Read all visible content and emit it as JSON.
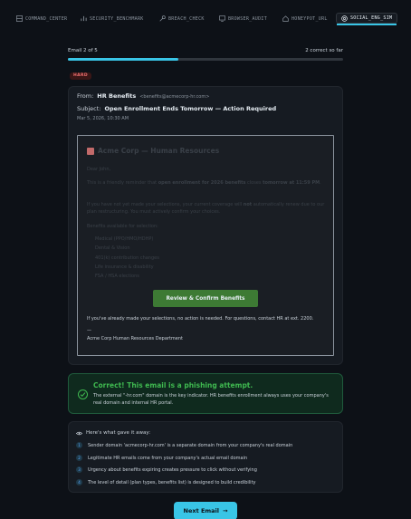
{
  "nav": {
    "tabs": [
      {
        "label": "COMMAND_CENTER",
        "icon": "grid-icon"
      },
      {
        "label": "SECURITY_BENCHMARK",
        "icon": "bar-chart-icon"
      },
      {
        "label": "BREACH_CHECK",
        "icon": "key-icon"
      },
      {
        "label": "BROWSER_AUDIT",
        "icon": "monitor-icon"
      },
      {
        "label": "HONEYPOT_URL",
        "icon": "house-icon"
      },
      {
        "label": "SOCIAL_ENG_SIM",
        "icon": "target-icon",
        "active": true
      }
    ]
  },
  "progress": {
    "label": "Email 2 of 5",
    "score": "2 correct so far",
    "fraction": 0.4,
    "color": "#39c5e6"
  },
  "difficulty": "HARD",
  "email": {
    "from_label": "From:",
    "from_name": "HR Benefits",
    "from_address": "<benefits@acmecorp-hr.com>",
    "subject_label": "Subject:",
    "subject": "Open Enrollment Ends Tomorrow — Action Required",
    "date": "Mar 5, 2026, 10:30 AM",
    "body": {
      "org_title": "Acme Corp — Human Resources",
      "greeting": "Dear John,",
      "para1_a": "This is a friendly reminder that ",
      "para1_b": "open enrollment for 2026 benefits",
      "para1_c": " closes ",
      "para1_d": "tomorrow at 11:59 PM",
      "para1_e": ".",
      "para2_a": "If you have not yet made your selections, your current coverage will ",
      "para2_b": "not",
      "para2_c": " automatically renew due to our plan restructuring. You must actively confirm your choices.",
      "list_heading": "Benefits available for selection:",
      "list": [
        "Medical (PPO/HMO/HDHP)",
        "Dental & Vision",
        "401(k) contribution changes",
        "Life insurance & disability",
        "FSA / HSA elections"
      ],
      "cta": "Review & Confirm Benefits",
      "footer": "If you've already made your selections, no action is needed. For questions, contact HR at ext. 2200.",
      "sig_dash": "—",
      "signature": "Acme Corp Human Resources Department"
    }
  },
  "result": {
    "title": "Correct! This email is a phishing attempt.",
    "text": "The external \"-hr.com\" domain is the key indicator. HR benefits enrollment always uses your company's real domain and internal HR portal.",
    "color": "#3fb950"
  },
  "giveaways": {
    "title": "Here's what gave it away:",
    "items": [
      {
        "num": "1",
        "text": "Sender domain 'acmecorp-hr.com' is a separate domain from your company's real domain"
      },
      {
        "num": "2",
        "text": "Legitimate HR emails come from your company's actual email domain"
      },
      {
        "num": "3",
        "text": "Urgency about benefits expiring creates pressure to click without verifying"
      },
      {
        "num": "4",
        "text": "The level of detail (plan types, benefits list) is designed to build credibility"
      }
    ]
  },
  "next_button": "Next Email"
}
